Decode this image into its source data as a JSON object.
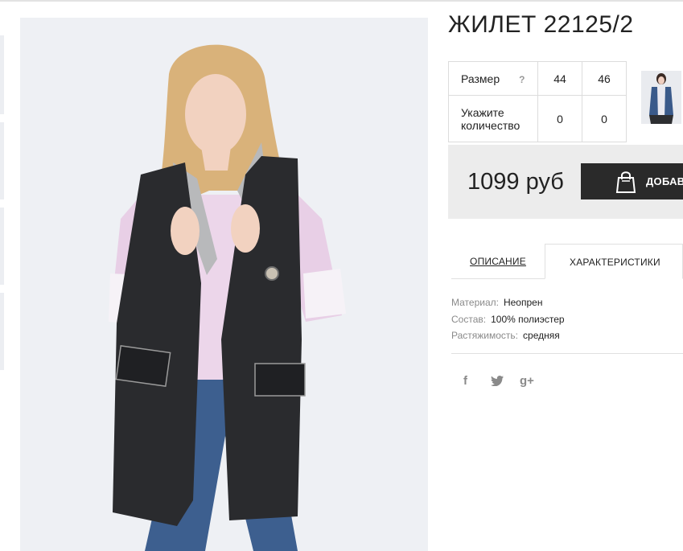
{
  "product": {
    "title": "ЖИЛЕТ 22125/2",
    "photo_icon": "product-photo",
    "alt_thumb_icon": "alt-photo-thumbnail"
  },
  "size_table": {
    "size_label": "Размер",
    "help_label": "?",
    "qty_label": "Укажите количество",
    "sizes": [
      "44",
      "46"
    ],
    "quantities": [
      "0",
      "0"
    ]
  },
  "purchase": {
    "price": "1099 руб",
    "cart_label": "ДОБАВИТЬ",
    "bag_icon": "shopping-bag-icon"
  },
  "tabs": {
    "description": "ОПИСАНИЕ",
    "specs": "ХАРАКТЕРИСТИКИ",
    "active": "specs"
  },
  "specs": {
    "material_label": "Материал:",
    "material_value": "Неопрен",
    "composition_label": "Состав:",
    "composition_value": "100% полиэстер",
    "stretch_label": "Растяжимость:",
    "stretch_value": "средняя"
  },
  "social": {
    "facebook": "f",
    "google": "g+",
    "icons": [
      "facebook-icon",
      "twitter-icon",
      "google-plus-icon"
    ]
  },
  "colors": {
    "button": "#2a2a2a",
    "price_bg": "#ececec",
    "border": "#dcdcdc",
    "muted": "#8a8a8a"
  }
}
